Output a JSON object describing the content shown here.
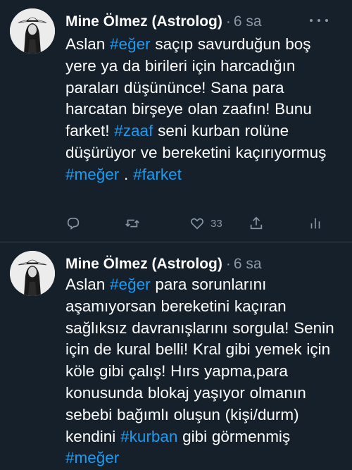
{
  "colors": {
    "background": "#15202b",
    "text": "#ffffff",
    "secondary": "#8b98a5",
    "hashtag": "#1d9bf0",
    "divider": "#38444d"
  },
  "tweets": [
    {
      "author": "Mine Ölmez (Astrolog)",
      "separator": "·",
      "time": "6 sa",
      "avatar_icon": "user-avatar-photo",
      "body": [
        {
          "text": "Aslan ",
          "hashtag": false
        },
        {
          "text": "#eğer",
          "hashtag": true
        },
        {
          "text": "  saçıp savurduğun boş yere ya da birileri için harcadığın paraları düşününce! Sana para harcatan birşeye olan zaafın! Bunu farket! ",
          "hashtag": false
        },
        {
          "text": "#zaaf",
          "hashtag": true
        },
        {
          "text": " seni kurban rolüne düşürüyor ve bereketini kaçırıyormuş ",
          "hashtag": false
        },
        {
          "text": "#meğer",
          "hashtag": true
        },
        {
          "text": " . ",
          "hashtag": false
        },
        {
          "text": "#farket",
          "hashtag": true
        }
      ],
      "actions": {
        "reply_icon": "reply-icon",
        "retweet_icon": "retweet-icon",
        "like_icon": "heart-icon",
        "like_count": "33",
        "share_icon": "share-icon",
        "analytics_icon": "analytics-icon"
      }
    },
    {
      "author": "Mine Ölmez (Astrolog)",
      "separator": "·",
      "time": "6 sa",
      "avatar_icon": "user-avatar-photo",
      "body": [
        {
          "text": "Aslan ",
          "hashtag": false
        },
        {
          "text": "#eğer",
          "hashtag": true
        },
        {
          "text": " para sorunlarını aşamıyorsan bereketini kaçıran sağlıksız davranışlarını sorgula! Senin için de kural belli! Kral gibi yemek için köle gibi çalış! Hırs yapma,para konusunda blokaj yaşıyor olmanın sebebi bağımlı oluşun (kişi/durm) kendini ",
          "hashtag": false
        },
        {
          "text": "#kurban",
          "hashtag": true
        },
        {
          "text": " gibi görmenmiş ",
          "hashtag": false
        },
        {
          "text": "#meğer",
          "hashtag": true
        }
      ]
    }
  ]
}
